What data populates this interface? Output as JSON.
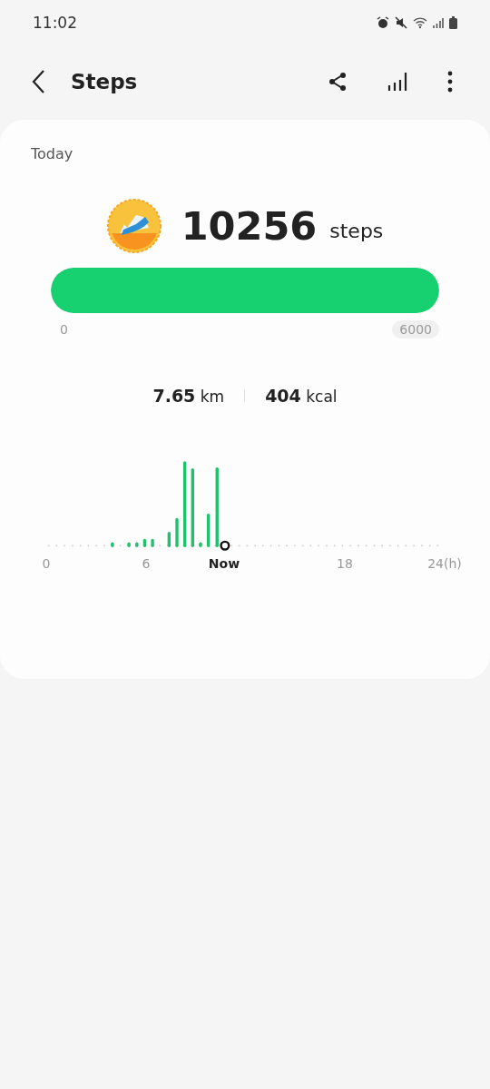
{
  "status_bar": {
    "time": "11:02"
  },
  "header": {
    "title": "Steps"
  },
  "card": {
    "period": "Today",
    "count": "10256",
    "unit": "steps",
    "progress": {
      "level": 1,
      "min_label": "0",
      "target_label": "6000"
    },
    "stats": [
      {
        "value": "7.65",
        "unit": "km"
      },
      {
        "value": "404",
        "unit": "kcal"
      }
    ],
    "timeline": {
      "labels": [
        {
          "text": "0",
          "current": false
        },
        {
          "text": "6",
          "current": false
        },
        {
          "text": "Now",
          "current": true
        },
        {
          "text": "18",
          "current": false
        },
        {
          "text": "24(h)",
          "current": false
        }
      ]
    }
  }
}
